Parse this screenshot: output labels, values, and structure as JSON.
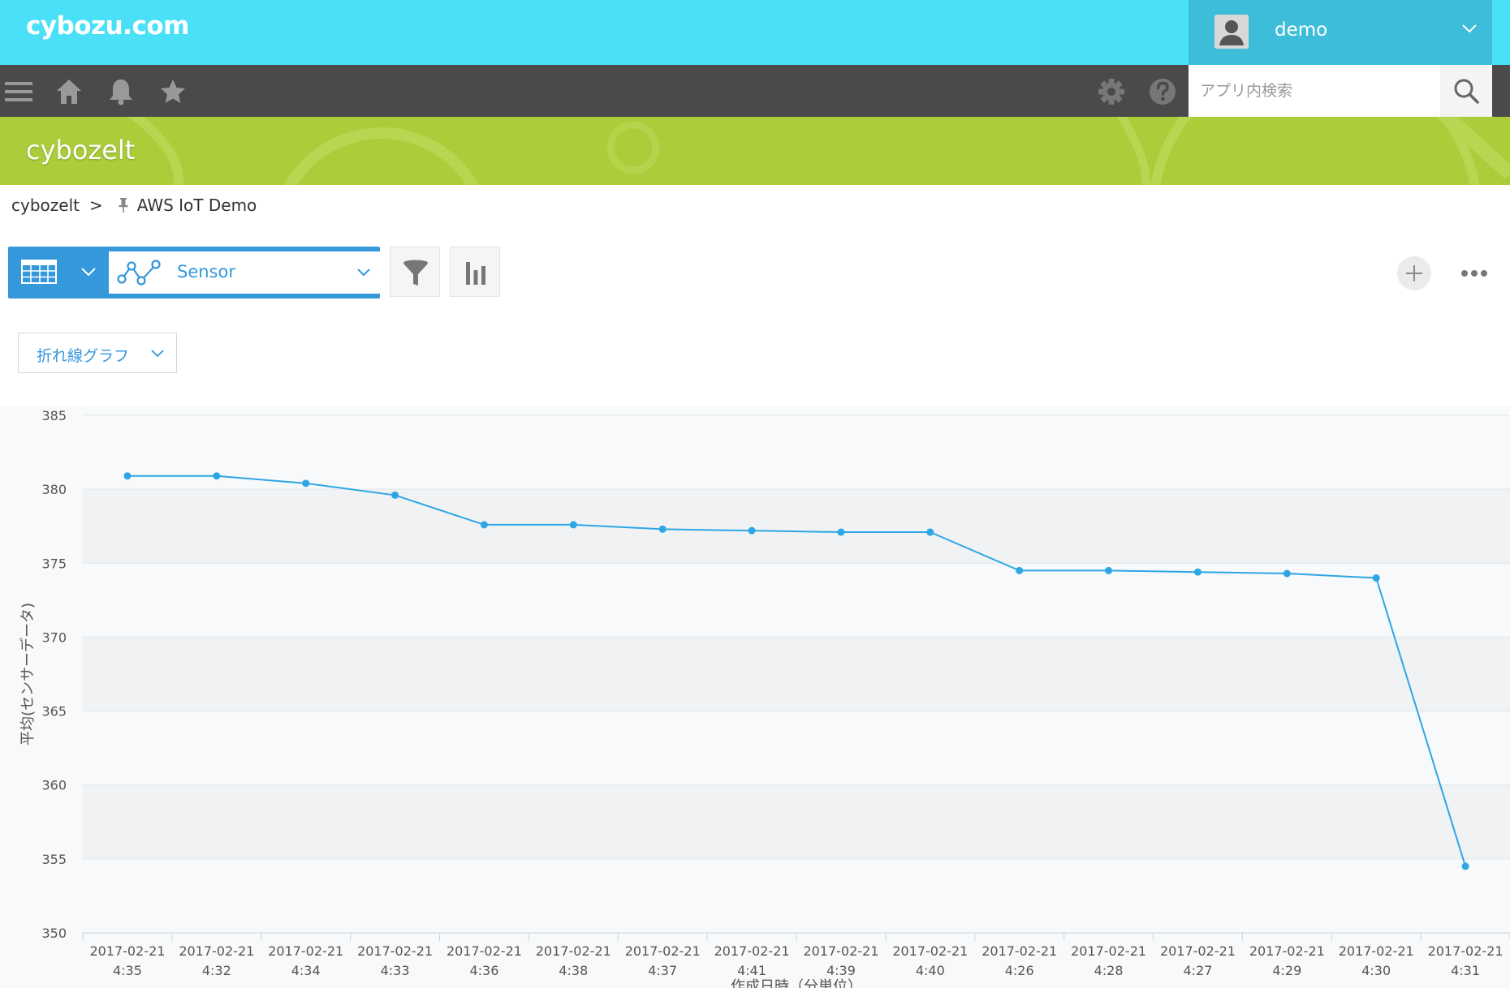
{
  "header": {
    "logo": "cybozu.com",
    "user_name": "demo"
  },
  "search": {
    "placeholder": "アプリ内検索"
  },
  "nav_icons": [
    "menu-icon",
    "home-icon",
    "bell-icon",
    "star-icon",
    "gear-icon",
    "help-icon",
    "search-icon"
  ],
  "banner": {
    "space_name": "cybozelt"
  },
  "breadcrumb": {
    "space": "cybozelt",
    "separator": ">",
    "app": "AWS IoT Demo"
  },
  "toolbar": {
    "view_label": "Sensor"
  },
  "chart_type_label": "折れ線グラフ",
  "colors": {
    "topbar": "#4ae0f7",
    "user": "#3dbdd9",
    "nav": "#4a4a4a",
    "banner": "#abcd3a",
    "accent": "#3498db",
    "series": "#2ea6e4"
  },
  "chart_data": {
    "type": "line",
    "ylabel": "平均(センサーデータ)",
    "xlabel": "作成日時（分単位）",
    "ylim": [
      350,
      385
    ],
    "yticks": [
      350,
      355,
      360,
      365,
      370,
      375,
      380,
      385
    ],
    "grid": true,
    "categories": [
      [
        "2017-02-21",
        "4:35"
      ],
      [
        "2017-02-21",
        "4:32"
      ],
      [
        "2017-02-21",
        "4:34"
      ],
      [
        "2017-02-21",
        "4:33"
      ],
      [
        "2017-02-21",
        "4:36"
      ],
      [
        "2017-02-21",
        "4:38"
      ],
      [
        "2017-02-21",
        "4:37"
      ],
      [
        "2017-02-21",
        "4:41"
      ],
      [
        "2017-02-21",
        "4:39"
      ],
      [
        "2017-02-21",
        "4:40"
      ],
      [
        "2017-02-21",
        "4:26"
      ],
      [
        "2017-02-21",
        "4:28"
      ],
      [
        "2017-02-21",
        "4:27"
      ],
      [
        "2017-02-21",
        "4:29"
      ],
      [
        "2017-02-21",
        "4:30"
      ],
      [
        "2017-02-21",
        "4:31"
      ]
    ],
    "values": [
      380.9,
      380.9,
      380.4,
      379.6,
      377.6,
      377.6,
      377.3,
      377.2,
      377.1,
      377.1,
      374.5,
      374.5,
      374.4,
      374.3,
      374.0,
      354.5
    ]
  }
}
